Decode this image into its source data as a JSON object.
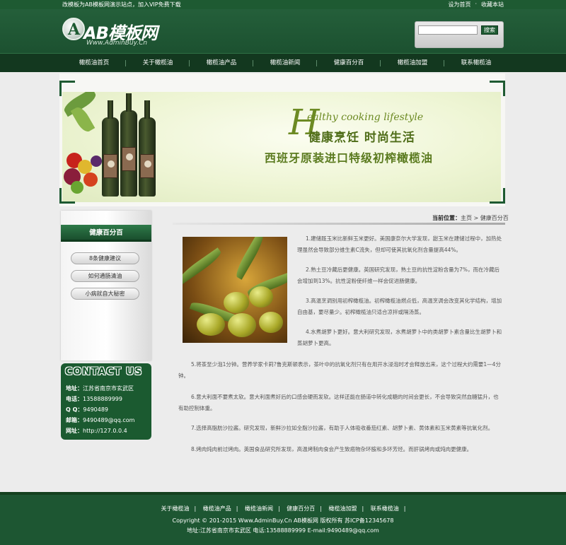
{
  "topbar": {
    "notice": "改模板为AB模板网演示站点，加入VIP免费下载",
    "set_home": "设为首页",
    "separator": "·",
    "favorite": "收藏本站"
  },
  "logo": {
    "mark_letter": "A",
    "brand": "AB模板网",
    "url": "Www.AdminBuy.Cn"
  },
  "search": {
    "value": "",
    "button_label": "搜索"
  },
  "nav": {
    "items": [
      "橄榄油首页",
      "关于橄榄油",
      "橄榄油产品",
      "橄榄油新闻",
      "健康百分百",
      "橄榄油加盟",
      "联系橄榄油"
    ]
  },
  "banner": {
    "big_letter": "H",
    "english": "ealthy cooking lifestyle",
    "slogan": "健康烹饪 时尚生活",
    "subtitle": "西班牙原装进口特级初榨橄榄油"
  },
  "sidebar": {
    "title": "健康百分百",
    "items": [
      "8条健康建议",
      "如何通肠清油",
      "小病就自大秘密"
    ]
  },
  "contact": {
    "title": "CONTACT US",
    "address_label": "地址：",
    "address": "江苏省南京市玄武区",
    "phone_label": "电话：",
    "phone": "13588889999",
    "qq_label": "Q Q：",
    "qq": "9490489",
    "email_label": "邮箱：",
    "email": "9490489@qq.com",
    "web_label": "网址：",
    "web": "http://127.0.0.4"
  },
  "breadcrumb": {
    "label": "当前位置：",
    "home": "主页",
    "sep": " > ",
    "current": "健康百分百"
  },
  "article": {
    "paragraphs": [
      "1.建储既玉米比新鲜玉米更好。美国康奈尔大学发现，甜玉米在建储过程中，加热处理虽然会导致部分维生素C流失，但却可使其抗氧化剂含量提高44%。",
      "2.熟土豆冷藏后更健康。英国研究发现，熟土豆的抗性淀粉含量为7%，而在冷藏后会增加到13%。抗性淀粉使纤维一样会促进肠健康。",
      "3.高温烹调别用初榨橄榄油。初榨橄榄油燃点低，高温烹调会改变其化学结构，增加自由基，要尽量少。初榨橄榄油只适合凉拌或隔汤蒸。",
      "4.水煮胡萝卜更好。意大利研究发现，水煮胡萝卜中的类胡萝卜素含量比生胡萝卜和蒸胡萝卜更高。",
      "5.将茶至少泡1分钟。营养学家卡莉?鲁克斯顿表示，茶叶中的抗氧化剂只有在用开水浸泡时才会释放出来，这个过程大约需要1—4分钟。",
      "6.意大利面不要煮太软。意大利面煮好后的口感会硬而发软。这样还能在肠道中转化成糖的时间会更长，不会导致突然血糖猛升，也有助控制体重。",
      "7.选择高脂肪沙拉酱。研究发现，新鲜沙拉如全脂沙拉酱，有助于人体吸收番茄红素、胡萝卜素、黄体素和玉米黄素等抗氧化剂。",
      "8.烤肉炖肉前过烤肉。英国食品研究所发现，高温烤制肉食会产生致癌物杂环胺和多环芳烃。而肝锅烤肉或炖肉更健康。"
    ]
  },
  "footer": {
    "links": [
      "关于橄榄油",
      "橄榄油产品",
      "橄榄油新闻",
      "健康百分百",
      "橄榄油加盟",
      "联系橄榄油"
    ],
    "separator": "|",
    "copyright": "Copyright © 201-2015 Www.AdminBuy.Cn AB模板网 版权所有   苏ICP备12345678",
    "address": "地址:江苏省南京市玄武区   电话:13588889999   E-mail:9490489@qq.com"
  },
  "colors": {
    "brand_green": "#1e5a32",
    "nav_dark": "#13381f",
    "olive_text": "#6c8a23"
  }
}
